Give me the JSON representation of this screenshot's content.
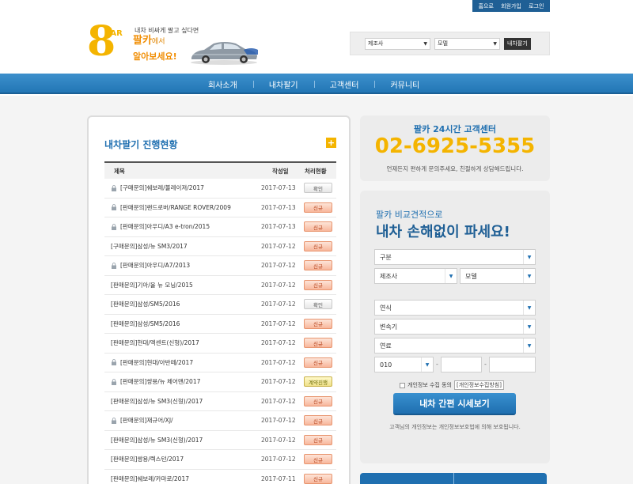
{
  "util_links": [
    "홈으로",
    "회원가입",
    "로그인"
  ],
  "logo": {
    "mark": "8",
    "car_text": "CAR"
  },
  "slogan": {
    "line1": "내차 비싸게 팔고 싶다면",
    "brand": "팔카",
    "brand_suffix": "에서",
    "line3": "알아보세요!"
  },
  "search": {
    "maker_label": "제조사",
    "model_label": "모델",
    "button": "내차팔기"
  },
  "nav": [
    "회사소개",
    "내차팔기",
    "고객센터",
    "커뮤니티"
  ],
  "progress": {
    "title": "내차팔기 진행현황",
    "more": "+",
    "columns": [
      "제목",
      "작성일",
      "처리현황"
    ],
    "rows": [
      {
        "title": "[구매문의]쉐보레/볼레이져/2017",
        "date": "2017-07-13",
        "status": "확인",
        "locked": true,
        "kind": "ok"
      },
      {
        "title": "[판매문의]랜드로버/RANGE ROVER/2009",
        "date": "2017-07-13",
        "status": "신규",
        "locked": true,
        "kind": "new"
      },
      {
        "title": "[판매문의]아우디/A3 e-tron/2015",
        "date": "2017-07-13",
        "status": "신규",
        "locked": true,
        "kind": "new"
      },
      {
        "title": "[구매문의]삼성/뉴 SM3/2017",
        "date": "2017-07-12",
        "status": "신규",
        "locked": false,
        "kind": "new"
      },
      {
        "title": "[판매문의]아우디/A7/2013",
        "date": "2017-07-12",
        "status": "신규",
        "locked": true,
        "kind": "new"
      },
      {
        "title": "[판매문의]기아/올 뉴 모닝/2015",
        "date": "2017-07-12",
        "status": "신규",
        "locked": false,
        "kind": "new"
      },
      {
        "title": "[판매문의]삼성/SM5/2016",
        "date": "2017-07-12",
        "status": "확인",
        "locked": false,
        "kind": "ok"
      },
      {
        "title": "[판매문의]삼성/SM5/2016",
        "date": "2017-07-12",
        "status": "신규",
        "locked": false,
        "kind": "new"
      },
      {
        "title": "[판매문의]현대/엑센트(신형)/2017",
        "date": "2017-07-12",
        "status": "신규",
        "locked": false,
        "kind": "new"
      },
      {
        "title": "[판매문의]현대/아반떼/2017",
        "date": "2017-07-12",
        "status": "신규",
        "locked": true,
        "kind": "new"
      },
      {
        "title": "[판매문의]쌍용/뉴 체어맨/2017",
        "date": "2017-07-12",
        "status": "계약진행",
        "locked": true,
        "kind": "prog"
      },
      {
        "title": "[판매문의]삼성/뉴 SM3(신형)/2017",
        "date": "2017-07-12",
        "status": "신규",
        "locked": false,
        "kind": "new"
      },
      {
        "title": "[판매문의]재규어/XJ/",
        "date": "2017-07-12",
        "status": "신규",
        "locked": true,
        "kind": "new"
      },
      {
        "title": "[판매문의]삼성/뉴 SM3(신형)/2017",
        "date": "2017-07-12",
        "status": "신규",
        "locked": false,
        "kind": "new"
      },
      {
        "title": "[판매문의]쌍용/렉스턴/2017",
        "date": "2017-07-12",
        "status": "신규",
        "locked": false,
        "kind": "new"
      },
      {
        "title": "[판매문의]쉐보레/카마로/2017",
        "date": "2017-07-11",
        "status": "신규",
        "locked": false,
        "kind": "new"
      }
    ]
  },
  "callcenter": {
    "title": "팔카 24시간 고객센터",
    "phone": "02-6925-5355",
    "desc": "언제든지 편하게 문의주세요, 친절하게 상담해드립니다."
  },
  "estimate": {
    "line1": "팔카 비교견적으로",
    "line2": "내차 손해없이 파세요!",
    "category": "구분",
    "maker": "제조사",
    "model": "모델",
    "year": "연식",
    "transmission": "변속기",
    "fuel": "연료",
    "phone_prefix": "010",
    "dash": "-",
    "agree_text": "개인정보 수집 동의",
    "agree_link": "[개인정보수집방침]",
    "button": "내차 간편 시세보기",
    "privacy": "고객님의 개인정보는 개인정보보호법에 의해 보호됩니다."
  }
}
